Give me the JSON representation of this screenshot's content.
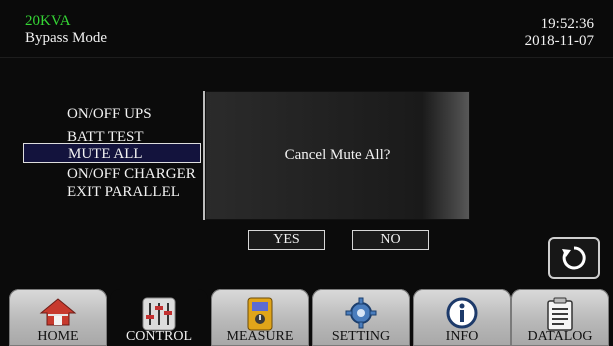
{
  "header": {
    "model": "20KVA",
    "mode": "Bypass Mode",
    "time": "19:52:36",
    "date": "2018-11-07"
  },
  "menu": {
    "items": [
      {
        "label": "ON/OFF UPS"
      },
      {
        "label": "BATT TEST"
      },
      {
        "label": "MUTE ALL",
        "selected": true
      },
      {
        "label": "ON/OFF CHARGER"
      },
      {
        "label": "EXIT PARALLEL"
      }
    ]
  },
  "dialog": {
    "message": "Cancel Mute All?",
    "yes_label": "YES",
    "no_label": "NO"
  },
  "back": {
    "icon": "refresh-icon"
  },
  "tabs": [
    {
      "label": "HOME",
      "icon": "home-icon"
    },
    {
      "label": "CONTROL",
      "icon": "sliders-icon",
      "active": true
    },
    {
      "label": "MEASURE",
      "icon": "multimeter-icon"
    },
    {
      "label": "SETTING",
      "icon": "gear-icon"
    },
    {
      "label": "INFO",
      "icon": "info-icon"
    },
    {
      "label": "DATALOG",
      "icon": "clipboard-icon"
    }
  ],
  "colors": {
    "model_green": "#35d635",
    "selection_bg": "#13133d",
    "tab_gray": "#b9b9b9"
  }
}
